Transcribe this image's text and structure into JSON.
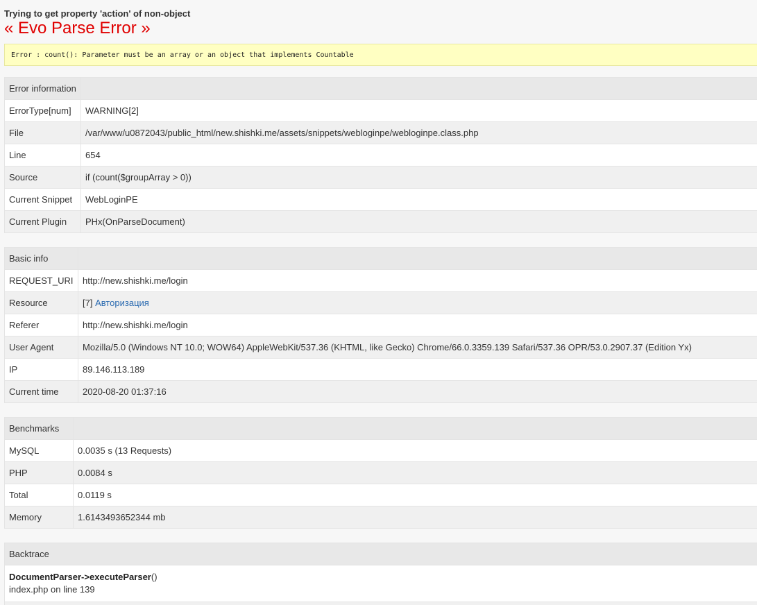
{
  "header": {
    "message": "Trying to get property 'action' of non-object",
    "title": "« Evo Parse Error »",
    "error_line": "Error : count(): Parameter must be an array or an object that implements Countable"
  },
  "error_info": {
    "heading": "Error information",
    "rows": [
      {
        "label": "ErrorType[num]",
        "value": "WARNING[2]"
      },
      {
        "label": "File",
        "value": "/var/www/u0872043/public_html/new.shishki.me/assets/snippets/webloginpe/webloginpe.class.php"
      },
      {
        "label": "Line",
        "value": "654"
      },
      {
        "label": "Source",
        "value": "if (count($groupArray > 0))"
      },
      {
        "label": "Current Snippet",
        "value": "WebLoginPE"
      },
      {
        "label": "Current Plugin",
        "value": "PHx(OnParseDocument)"
      }
    ]
  },
  "basic_info": {
    "heading": "Basic info",
    "rows": [
      {
        "label": "REQUEST_URI",
        "value": "http://new.shishki.me/login"
      },
      {
        "label": "Resource",
        "value_prefix": "[7] ",
        "value_link": "Авторизация"
      },
      {
        "label": "Referer",
        "value": "http://new.shishki.me/login"
      },
      {
        "label": "User Agent",
        "value": "Mozilla/5.0 (Windows NT 10.0; WOW64) AppleWebKit/537.36 (KHTML, like Gecko) Chrome/66.0.3359.139 Safari/537.36 OPR/53.0.2907.37 (Edition Yx)"
      },
      {
        "label": "IP",
        "value": "89.146.113.189"
      },
      {
        "label": "Current time",
        "value": "2020-08-20 01:37:16"
      }
    ]
  },
  "benchmarks": {
    "heading": "Benchmarks",
    "rows": [
      {
        "label": "MySQL",
        "value": "0.0035 s (13 Requests)"
      },
      {
        "label": "PHP",
        "value": "0.0084 s"
      },
      {
        "label": "Total",
        "value": "0.0119 s"
      },
      {
        "label": "Memory",
        "value": "1.6143493652344 mb"
      }
    ]
  },
  "backtrace": {
    "heading": "Backtrace",
    "entries": [
      {
        "function": "DocumentParser->executeParser",
        "args": "()",
        "location": "index.php on line 139"
      }
    ]
  },
  "colors": {
    "title_red": "#e00000",
    "error_bg": "#ffffc2",
    "link": "#2a6ab0",
    "header_bg": "#e8e8e8",
    "alt_bg": "#f0f0f0"
  }
}
